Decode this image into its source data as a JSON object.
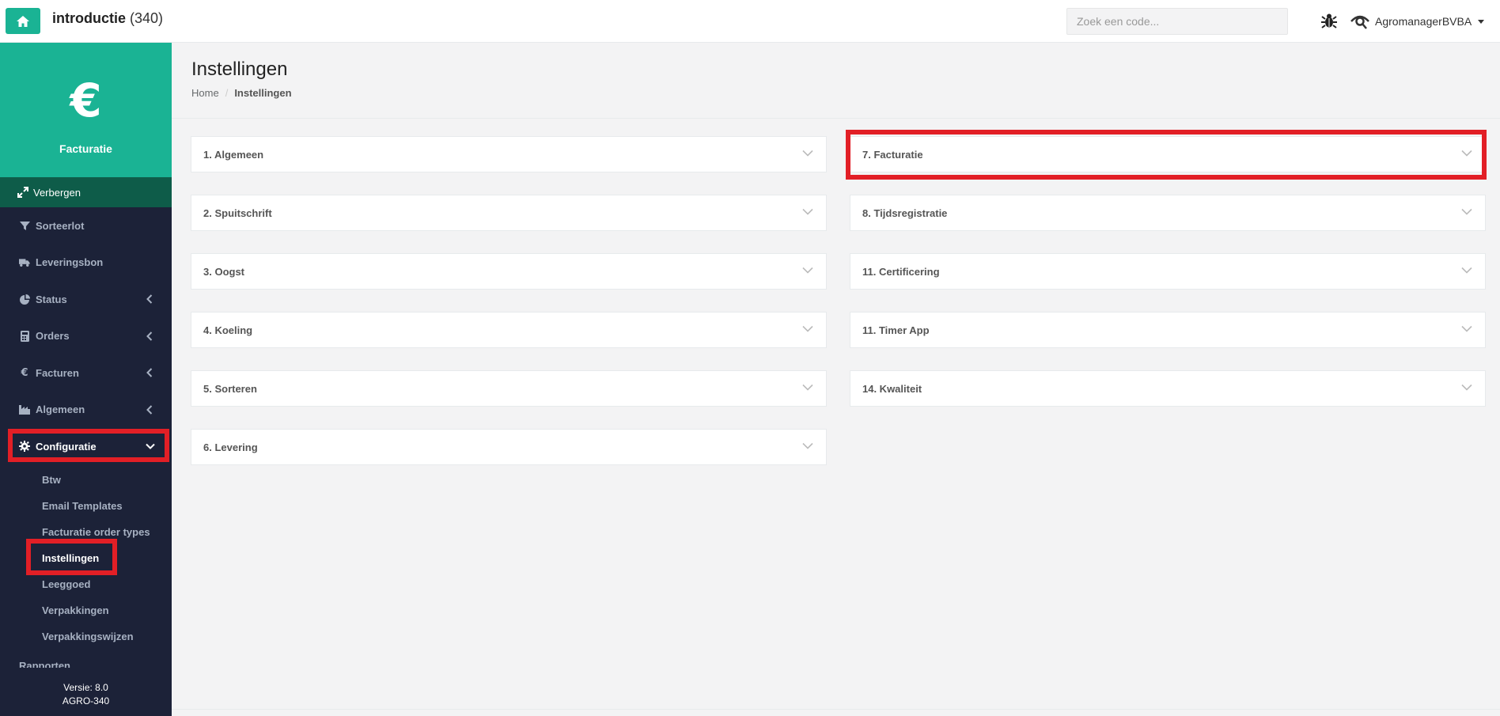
{
  "topbar": {
    "title": "introductie",
    "count": "(340)",
    "search_placeholder": "Zoek een code...",
    "user_name": "AgromanagerBVBA"
  },
  "sidebar": {
    "module_title": "Facturatie",
    "module_icon": "€",
    "hide_label": "Verbergen",
    "items": [
      {
        "label": "Sorteerlot",
        "icon": "filter-icon"
      },
      {
        "label": "Leveringsbon",
        "icon": "truck-icon"
      },
      {
        "label": "Status",
        "icon": "pie-chart-icon"
      },
      {
        "label": "Orders",
        "icon": "calculator-icon"
      },
      {
        "label": "Facturen",
        "icon": "euro-icon"
      },
      {
        "label": "Algemeen",
        "icon": "factory-icon"
      },
      {
        "label": "Configuratie",
        "icon": "gear-icon"
      }
    ],
    "sub_items": [
      {
        "label": "Btw"
      },
      {
        "label": "Email Templates"
      },
      {
        "label": "Facturatie order types"
      },
      {
        "label": "Instellingen"
      },
      {
        "label": "Leeggoed"
      },
      {
        "label": "Verpakkingen"
      },
      {
        "label": "Verpakkingswijzen"
      }
    ],
    "partial_item": "Rapporten",
    "footer_version": "Versie: 8.0",
    "footer_build": "AGRO-340"
  },
  "page": {
    "title": "Instellingen",
    "breadcrumb_home": "Home",
    "breadcrumb_current": "Instellingen"
  },
  "panels_left": [
    {
      "label": "1. Algemeen"
    },
    {
      "label": "2. Spuitschrift"
    },
    {
      "label": "3. Oogst"
    },
    {
      "label": "4. Koeling"
    },
    {
      "label": "5. Sorteren"
    },
    {
      "label": "6. Levering"
    }
  ],
  "panels_right": [
    {
      "label": "7. Facturatie"
    },
    {
      "label": "8. Tijdsregistratie"
    },
    {
      "label": "11. Certificering"
    },
    {
      "label": "11. Timer App"
    },
    {
      "label": "14. Kwaliteit"
    }
  ],
  "colors": {
    "accent": "#1ab394",
    "sidebar": "#1c2238",
    "highlight": "#e21f26"
  }
}
